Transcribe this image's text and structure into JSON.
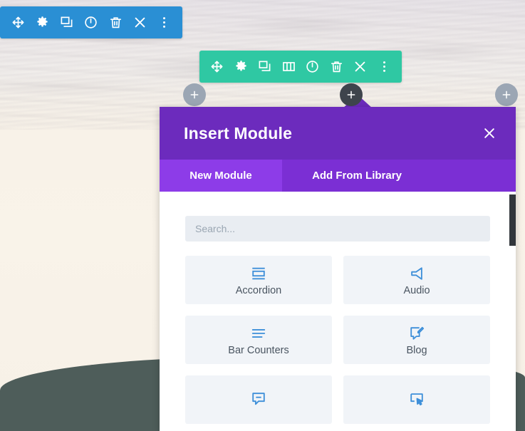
{
  "module_toolbar": {
    "name": "module-settings-toolbar",
    "color": "#2a8fd4",
    "icons": [
      {
        "name": "move-icon",
        "title": "Move Module"
      },
      {
        "name": "gear-icon",
        "title": "Module Settings"
      },
      {
        "name": "duplicate-icon",
        "title": "Duplicate Module"
      },
      {
        "name": "power-icon",
        "title": "Disable Module"
      },
      {
        "name": "trash-icon",
        "title": "Delete Module"
      },
      {
        "name": "close-icon",
        "title": "Close"
      },
      {
        "name": "more-options-icon",
        "title": "More Options"
      }
    ]
  },
  "row_toolbar": {
    "name": "row-settings-toolbar",
    "color": "#2fc8a3",
    "icons": [
      {
        "name": "move-icon",
        "title": "Move Row"
      },
      {
        "name": "gear-icon",
        "title": "Row Settings"
      },
      {
        "name": "duplicate-icon",
        "title": "Duplicate Row"
      },
      {
        "name": "columns-icon",
        "title": "Change Column Structure"
      },
      {
        "name": "power-icon",
        "title": "Disable Row"
      },
      {
        "name": "trash-icon",
        "title": "Delete Row"
      },
      {
        "name": "close-icon",
        "title": "Close"
      },
      {
        "name": "more-options-icon",
        "title": "More Options"
      }
    ]
  },
  "add_buttons": [
    {
      "name": "add-module-left",
      "label": "+",
      "color": "#9ba6b4",
      "state": "inactive"
    },
    {
      "name": "add-module-center",
      "label": "+",
      "color": "#3e444c",
      "state": "active"
    },
    {
      "name": "add-module-right",
      "label": "+",
      "color": "#9ba6b4",
      "state": "inactive"
    }
  ],
  "modal": {
    "title": "Insert Module",
    "close_label": "×",
    "header_color": "#6c2bbd",
    "tabbar_color": "#7b2fd4",
    "active_tab_color": "#8d3ce8",
    "tabs": [
      {
        "label": "New Module",
        "active": true
      },
      {
        "label": "Add From Library",
        "active": false
      }
    ],
    "search": {
      "placeholder": "Search...",
      "value": ""
    },
    "modules": [
      {
        "label": "Accordion",
        "icon": "accordion-icon"
      },
      {
        "label": "Audio",
        "icon": "audio-icon"
      },
      {
        "label": "Bar Counters",
        "icon": "bar-counters-icon"
      },
      {
        "label": "Blog",
        "icon": "blog-icon"
      },
      {
        "label": "",
        "icon": "blurb-icon"
      },
      {
        "label": "",
        "icon": "button-icon"
      }
    ],
    "accent_color": "#3e8fd9"
  }
}
